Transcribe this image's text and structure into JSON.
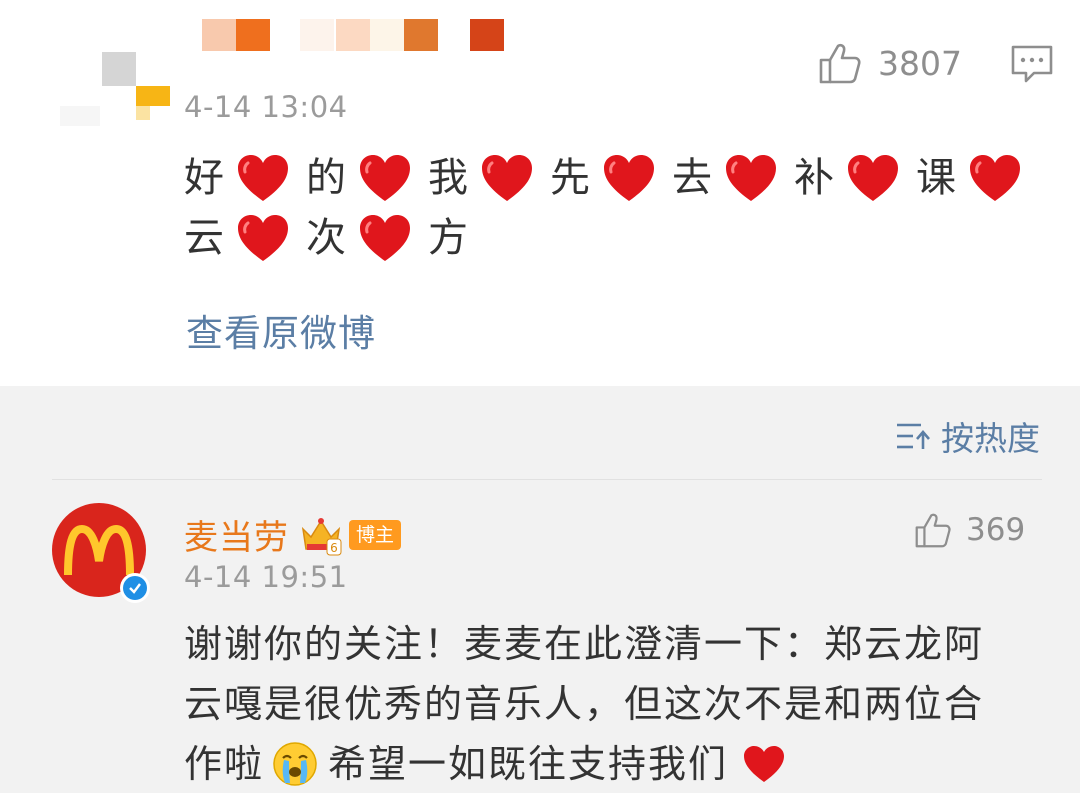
{
  "post": {
    "time": "4-14 13:04",
    "like_count": "3807",
    "body_line1": [
      "好",
      "的",
      "我",
      "先",
      "去",
      "补",
      "课"
    ],
    "body_line2": [
      "云",
      "次",
      "方"
    ],
    "view_original_label": "查看原微博"
  },
  "comments_section": {
    "sort_label": "按热度",
    "comment": {
      "author": "麦当劳",
      "author_badge": "博主",
      "crown_level": "6",
      "time": "4-14 19:51",
      "like_count": "369",
      "lines": [
        "谢谢你的关注！麦麦在此澄清一下：郑云龙阿",
        "云嘎是很优秀的音乐人，但这次不是和两位合"
      ],
      "line3_before_emoji": "作啦",
      "line3_after_emoji": "希望一如既往支持我们"
    }
  },
  "icons": {
    "like": "thumbs-up-icon",
    "comment": "comment-bubble-icon",
    "sort": "sort-icon",
    "heart": "red-heart-emoji",
    "cry": "crying-face-emoji",
    "verified": "verified-check-icon",
    "crown": "crown-icon"
  },
  "colors": {
    "link": "#5b7ea5",
    "author": "#e8781b",
    "badge": "#ff9a1f",
    "heart": "#e0161c",
    "mcdonalds_red": "#d9251c",
    "mcdonalds_yellow": "#ffc72c"
  }
}
